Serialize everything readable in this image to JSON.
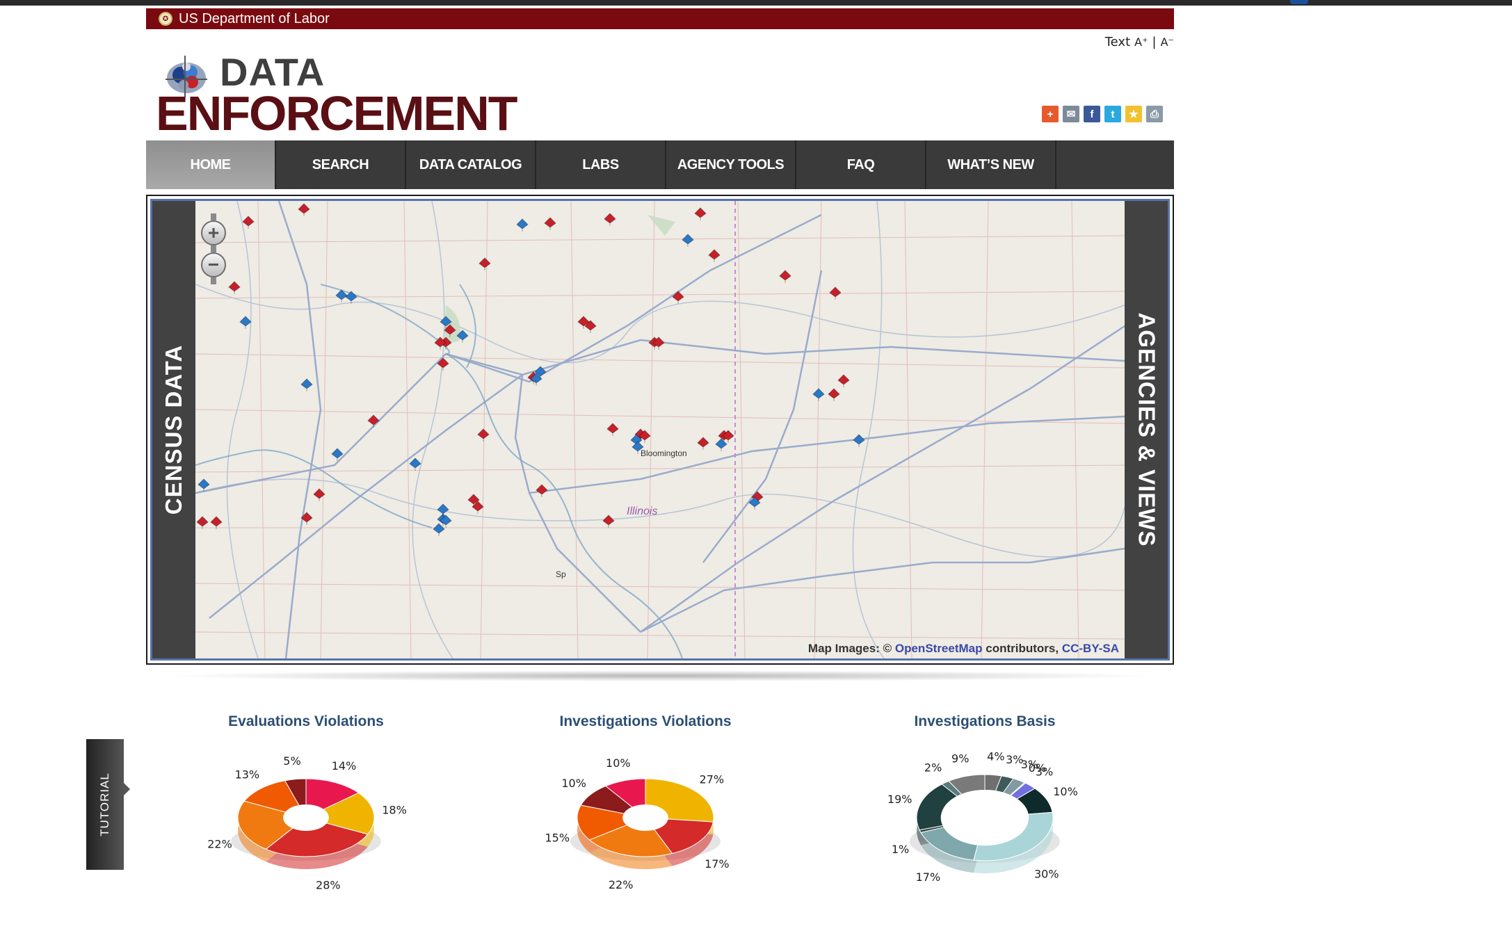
{
  "header": {
    "agency": "US Department of Labor",
    "text_size_label": "Text",
    "increase_label": "A⁺",
    "separator": "|",
    "decrease_label": "A⁻",
    "logo_line1": "DATA",
    "logo_line2": "ENFORCEMENT"
  },
  "share_icons": [
    {
      "name": "add-icon",
      "glyph": "+",
      "color": "#e65a2e"
    },
    {
      "name": "email-icon",
      "glyph": "✉",
      "color": "#7d8a99"
    },
    {
      "name": "facebook-icon",
      "glyph": "f",
      "color": "#3b5998"
    },
    {
      "name": "twitter-icon",
      "glyph": "t",
      "color": "#2aa9e0"
    },
    {
      "name": "favorite-icon",
      "glyph": "★",
      "color": "#f2c12e"
    },
    {
      "name": "print-icon",
      "glyph": "⎙",
      "color": "#8a9aa6"
    }
  ],
  "nav": {
    "items": [
      {
        "label": "HOME",
        "active": true
      },
      {
        "label": "SEARCH"
      },
      {
        "label": "DATA CATALOG"
      },
      {
        "label": "LABS"
      },
      {
        "label": "AGENCY TOOLS"
      },
      {
        "label": "FAQ"
      },
      {
        "label": "WHAT’S NEW"
      }
    ]
  },
  "map": {
    "left_tab": "CENSUS DATA",
    "right_tab": "AGENCIES & VIEWS",
    "zoom_in": "+",
    "zoom_out": "−",
    "city_label": "Bloomington",
    "city_label_2": "Sp",
    "state_label": "Illinois",
    "attribution_prefix": "Map Images: ©",
    "attribution_link1": "OpenStreetMap",
    "attribution_middle": "contributors,",
    "attribution_link2": "CC-BY-SA",
    "marker_colors": {
      "red": "#c8202a",
      "blue": "#2a78c8"
    }
  },
  "tutorial": {
    "label": "TUTORIAL"
  },
  "chart_data": [
    {
      "type": "pie",
      "title": "Evaluations Violations",
      "labels": [
        "14%",
        "18%",
        "28%",
        "22%",
        "13%",
        "5%"
      ],
      "values": [
        14,
        18,
        28,
        22,
        13,
        5
      ],
      "colors": [
        "#e8184f",
        "#f0b400",
        "#d42a2a",
        "#f07a10",
        "#f05a00",
        "#8c1b1b"
      ]
    },
    {
      "type": "pie",
      "title": "Investigations Violations",
      "labels": [
        "27%",
        "17%",
        "22%",
        "15%",
        "10%",
        "10%"
      ],
      "values": [
        27,
        17,
        22,
        15,
        10,
        10
      ],
      "colors": [
        "#f0b400",
        "#d42a2a",
        "#f07a10",
        "#f05a00",
        "#8c1b1b",
        "#e8184f"
      ]
    },
    {
      "type": "pie",
      "title": "Investigations Basis",
      "labels": [
        "4%",
        "3%",
        "3%",
        "0%",
        "3%",
        "10%",
        "30%",
        "17%",
        "1%",
        "19%",
        "2%",
        "9%"
      ],
      "values": [
        4,
        3,
        3,
        0.3,
        3,
        10,
        30,
        17,
        1,
        19,
        2,
        9
      ],
      "colors": [
        "#6f6f6f",
        "#3f5a5a",
        "#7f9aa0",
        "#b8b8ff",
        "#7070e0",
        "#0f2a2a",
        "#a9d5d8",
        "#7fa8ad",
        "#2d4747",
        "#214040",
        "#5c7b7b",
        "#7a7a7a"
      ]
    }
  ]
}
